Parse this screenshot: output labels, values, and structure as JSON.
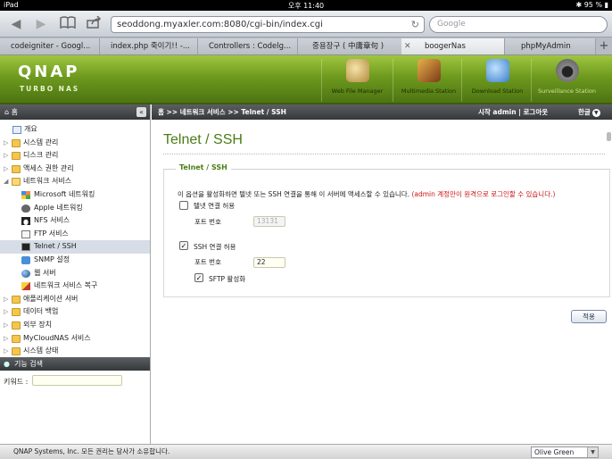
{
  "status_bar": {
    "carrier": "iPad",
    "time": "오후 11:40",
    "battery": "95 %"
  },
  "browser": {
    "url": "seoddong.myaxler.com:8080/cgi-bin/index.cgi",
    "search_placeholder": "Google",
    "tabs": [
      {
        "label": "codeigniter - Googl...",
        "active": false
      },
      {
        "label": "index.php 죽이기!! -...",
        "active": false
      },
      {
        "label": "Controllers : Codelg...",
        "active": false
      },
      {
        "label": "중용장구 ( 中庸章句 )",
        "active": false
      },
      {
        "label": "boogerNas",
        "active": true
      },
      {
        "label": "phpMyAdmin",
        "active": false
      }
    ],
    "new_tab_label": "+"
  },
  "qnap": {
    "logo": "QNAP",
    "subtitle": "TURBO NAS",
    "modules": [
      {
        "label": "Web File Manager",
        "icon": "web-file-manager-icon",
        "color": "#c9a35a"
      },
      {
        "label": "Multimedia Station",
        "icon": "multimedia-station-icon",
        "color": "#7b3a17"
      },
      {
        "label": "Download Station",
        "icon": "download-station-icon",
        "color": "#3a7fc9"
      },
      {
        "label": "Surveillance Station",
        "icon": "surveillance-station-icon",
        "color": "#555555"
      }
    ]
  },
  "left_panel": {
    "home_label": "홈",
    "collapse_label": "«",
    "tree": [
      {
        "label": "개요",
        "icon": "overview-icon",
        "arrow": "",
        "indent": 1
      },
      {
        "label": "시스템 관리",
        "icon": "folder-icon",
        "arrow": "▷",
        "indent": 0
      },
      {
        "label": "디스크 관리",
        "icon": "folder-icon",
        "arrow": "▷",
        "indent": 0
      },
      {
        "label": "액세스 권한 관리",
        "icon": "folder-icon",
        "arrow": "▷",
        "indent": 0
      },
      {
        "label": "네트워크 서비스",
        "icon": "folder-open-icon",
        "arrow": "◢",
        "indent": 0
      },
      {
        "label": "Microsoft 네트워킹",
        "icon": "windows-icon",
        "arrow": "",
        "indent": 2
      },
      {
        "label": "Apple 네트워킹",
        "icon": "apple-icon",
        "arrow": "",
        "indent": 2
      },
      {
        "label": "NFS 서비스",
        "icon": "linux-icon",
        "arrow": "",
        "indent": 2
      },
      {
        "label": "FTP 서비스",
        "icon": "ftp-icon",
        "arrow": "",
        "indent": 2
      },
      {
        "label": "Telnet / SSH",
        "icon": "terminal-icon",
        "arrow": "",
        "indent": 2,
        "selected": true
      },
      {
        "label": "SNMP 설정",
        "icon": "snmp-icon",
        "arrow": "",
        "indent": 2
      },
      {
        "label": "웹 서버",
        "icon": "globe-icon",
        "arrow": "",
        "indent": 2
      },
      {
        "label": "네트워크 서비스 복구",
        "icon": "repair-icon",
        "arrow": "",
        "indent": 2
      },
      {
        "label": "애플리케이션 서버",
        "icon": "folder-icon",
        "arrow": "▷",
        "indent": 0
      },
      {
        "label": "데이터 백업",
        "icon": "folder-icon",
        "arrow": "▷",
        "indent": 0
      },
      {
        "label": "외부 장치",
        "icon": "folder-icon",
        "arrow": "▷",
        "indent": 0
      },
      {
        "label": "MyCloudNAS 서비스",
        "icon": "folder-icon",
        "arrow": "▷",
        "indent": 0
      },
      {
        "label": "시스템 상태",
        "icon": "folder-icon",
        "arrow": "▷",
        "indent": 0
      }
    ],
    "search_title": "기능 검색",
    "keyword_label": "키워드 :"
  },
  "breadcrumb": {
    "path": "홈 >> 네트워크 서비스 >> Telnet / SSH",
    "user": "시작 admin | 로그아웃",
    "language": "한글"
  },
  "page": {
    "title": "Telnet / SSH",
    "section_title": "Telnet / SSH",
    "description": "이 옵션을 활성화하면 텔넷 또는 SSH 연결을 통해 이 서버에 액세스할 수 있습니다.",
    "warning": "(admin 계정만이 원격으로 로그인할 수 있습니다.)",
    "telnet": {
      "label": "텔넷 연결 허용",
      "checked": false,
      "port_label": "포트 번호",
      "port": "13131"
    },
    "ssh": {
      "label": "SSH 연결 허용",
      "checked": true,
      "port_label": "포트 번호",
      "port": "22"
    },
    "sftp": {
      "label": "SFTP 활성화",
      "checked": true
    },
    "apply_label": "적용"
  },
  "footer": {
    "copyright": "QNAP Systems, Inc. 모든 권리는 당사가 소유합니다.",
    "theme": "Olive Green"
  }
}
